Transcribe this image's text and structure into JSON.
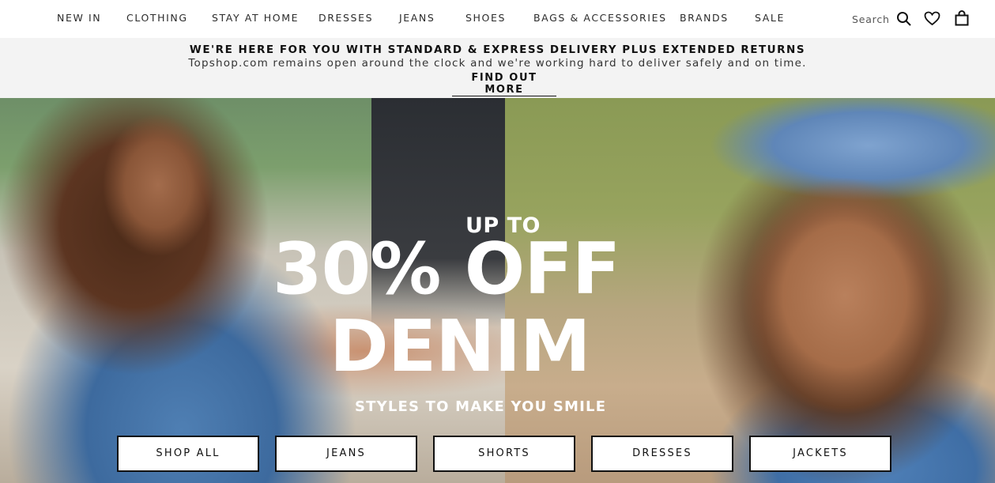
{
  "nav": {
    "items": [
      {
        "label": "NEW IN"
      },
      {
        "label": "CLOTHING"
      },
      {
        "label": "STAY AT HOME"
      },
      {
        "label": "DRESSES"
      },
      {
        "label": "JEANS"
      },
      {
        "label": "SHOES"
      },
      {
        "label": "BAGS & ACCESSORIES"
      },
      {
        "label": "BRANDS"
      },
      {
        "label": "SALE"
      }
    ],
    "search_label": "Search",
    "icons": [
      "search-icon",
      "heart-icon",
      "bag-icon"
    ]
  },
  "banner": {
    "title": "WE'RE HERE FOR YOU WITH STANDARD & EXPRESS DELIVERY PLUS EXTENDED RETURNS",
    "text": "Topshop.com remains open around the clock and we're working hard to deliver safely and on time.",
    "link": "FIND OUT MORE"
  },
  "hero": {
    "kicker": "UP TO",
    "headline_line1": "30% OFF",
    "headline_line2": "DENIM",
    "tagline": "STYLES TO MAKE YOU SMILE",
    "buttons": [
      {
        "label": "SHOP ALL"
      },
      {
        "label": "JEANS"
      },
      {
        "label": "SHORTS"
      },
      {
        "label": "DRESSES"
      },
      {
        "label": "JACKETS"
      }
    ]
  },
  "colors": {
    "banner_bg": "#f3f3f3",
    "text": "#222222",
    "hero_text": "#ffffff"
  }
}
